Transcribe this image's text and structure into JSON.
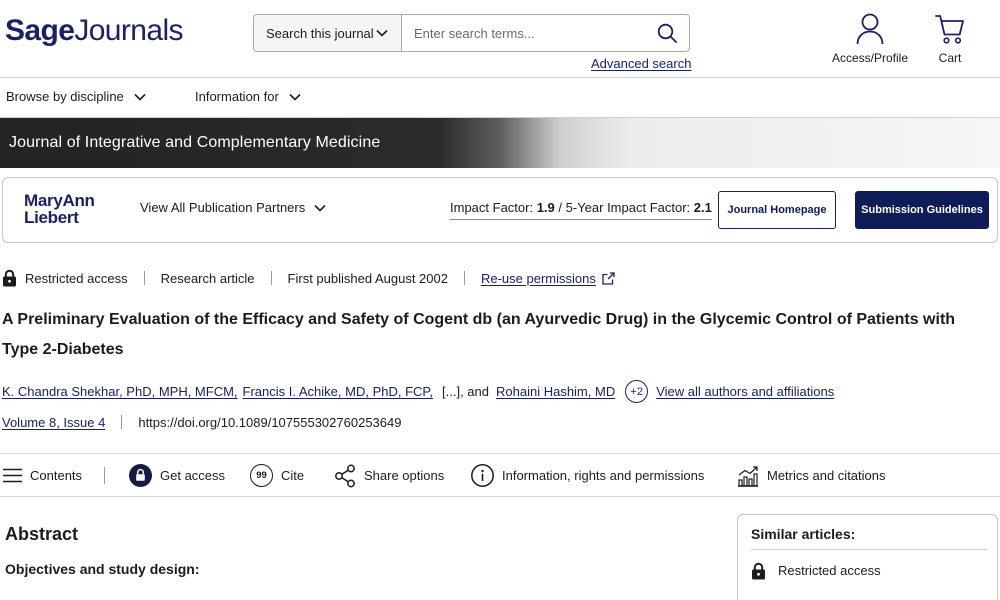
{
  "colors": {
    "brand_navy": "#1b2167",
    "button_navy": "#0e1d57",
    "text": "#1c1c1c",
    "divider": "#cfcfcf",
    "banner_dark": "#262626"
  },
  "header": {
    "logo": {
      "primary": "Sage",
      "secondary": "Journals"
    },
    "search": {
      "scope_label": "Search this journal",
      "scope_icon": "chevron-down-icon",
      "placeholder": "Enter search terms...",
      "button_icon": "search-icon",
      "advanced_label": "Advanced search"
    },
    "account": {
      "label": "Access/Profile",
      "icon": "person-icon"
    },
    "cart": {
      "label": "Cart",
      "icon": "cart-icon"
    }
  },
  "nav": {
    "items": [
      {
        "label": "Browse by discipline",
        "icon": "chevron-down-icon"
      },
      {
        "label": "Information for",
        "icon": "chevron-down-icon"
      }
    ]
  },
  "journal": {
    "title": "Journal of Integrative and Complementary Medicine",
    "publisher_logo": {
      "line1": "MaryAnn",
      "line2": "Liebert"
    },
    "partners_label": "View All Publication Partners",
    "metrics": {
      "impact_label": "Impact Factor:",
      "impact_value": "1.9",
      "five_year_label": "/ 5-Year Impact Factor:",
      "five_year_value": "2.1"
    },
    "homepage_label": "Journal Homepage",
    "guidelines_label": "Submission Guidelines"
  },
  "article": {
    "meta": {
      "access": "Restricted access",
      "access_icon": "lock-icon",
      "type": "Research article",
      "published": "First published August 2002",
      "reuse_label": "Re-use permissions",
      "reuse_icon": "external-link-icon"
    },
    "title": "A Preliminary Evaluation of the Efficacy and Safety of Cogent db (an Ayurvedic Drug) in the Glycemic Control of Patients with Type 2-Diabetes",
    "authors": [
      {
        "name": "K. Chandra Shekhar, PhD, MPH, MFCM,"
      },
      {
        "name": "Francis I. Achike, MD, PhD, FCP,"
      },
      {
        "name": "Rohaini Hashim, MD"
      }
    ],
    "authors_truncation": "[...], and",
    "more_authors": "+2",
    "all_authors_label": "View all authors and affiliations",
    "volume_issue": "Volume 8, Issue 4",
    "doi": "https://doi.org/10.1089/107555302760253649"
  },
  "toolbar": {
    "items": [
      {
        "label": "Contents",
        "icon": "menu-icon"
      },
      {
        "label": "Get access",
        "icon": "lock-circle-icon"
      },
      {
        "label": "Cite",
        "icon": "quote-icon",
        "glyph": "99"
      },
      {
        "label": "Share options",
        "icon": "share-icon"
      },
      {
        "label": "Information, rights and permissions",
        "icon": "info-icon"
      },
      {
        "label": "Metrics and citations",
        "icon": "metrics-icon"
      }
    ]
  },
  "abstract": {
    "heading": "Abstract",
    "section_heading": "Objectives and study design:"
  },
  "sidebar": {
    "heading": "Similar articles:",
    "items": [
      {
        "access": "Restricted access",
        "icon": "lock-icon"
      }
    ]
  }
}
